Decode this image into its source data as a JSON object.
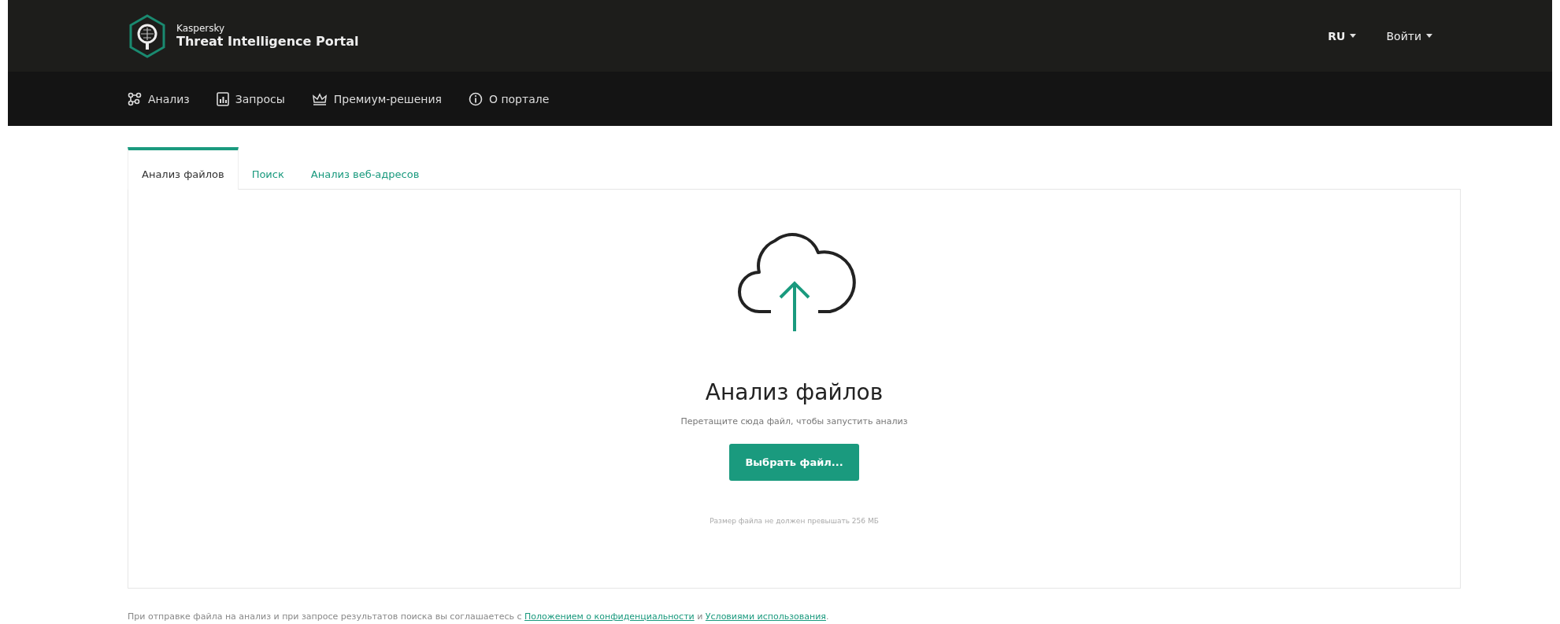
{
  "header": {
    "brand": "Kaspersky",
    "product": "Threat Intelligence Portal",
    "language": "RU",
    "login": "Войти"
  },
  "nav": [
    {
      "label": "Анализ"
    },
    {
      "label": "Запросы"
    },
    {
      "label": "Премиум-решения"
    },
    {
      "label": "О портале"
    }
  ],
  "tabs": [
    {
      "label": "Анализ файлов",
      "selected": true
    },
    {
      "label": "Поиск",
      "selected": false
    },
    {
      "label": "Анализ веб-адресов",
      "selected": false
    }
  ],
  "upload": {
    "title": "Анализ файлов",
    "hint": "Перетащите сюда файл, чтобы запустить анализ",
    "button": "Выбрать файл...",
    "limit": "Размер файла не должен превышать 256 МБ"
  },
  "notice": {
    "text": "При отправке файла на анализ и при запросе результатов поиска вы соглашаетесь с ",
    "privacy_link": "Положением о конфиденциальности",
    "middle": " и ",
    "terms_link": "Условиями использования",
    "end": "."
  }
}
